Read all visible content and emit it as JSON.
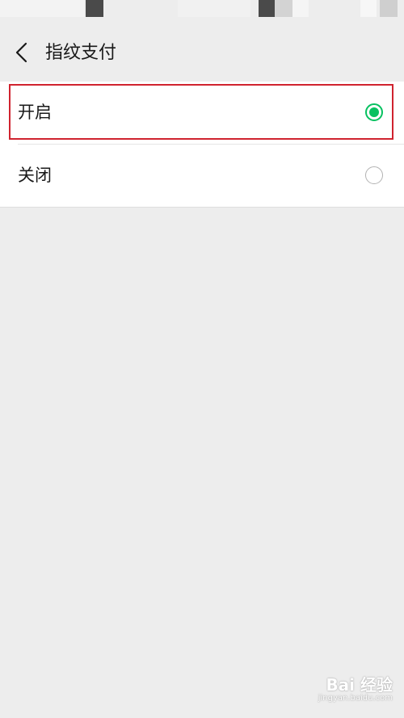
{
  "nav": {
    "title": "指纹支付"
  },
  "options": [
    {
      "label": "开启",
      "selected": true
    },
    {
      "label": "关闭",
      "selected": false
    }
  ],
  "colors": {
    "accent": "#07c160",
    "highlight": "#d0232f",
    "background": "#ededed"
  },
  "watermark": {
    "brand": "Bai 经验",
    "url": "jingyan.baidu.com"
  }
}
